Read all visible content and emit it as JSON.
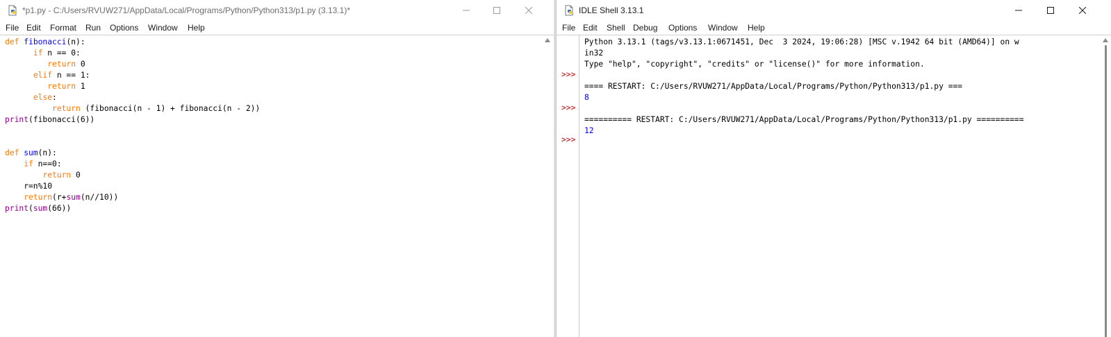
{
  "editor": {
    "title": "*p1.py - C:/Users/RVUW271/AppData/Local/Programs/Python/Python313/p1.py (3.13.1)*",
    "menu": [
      "File",
      "Edit",
      "Format",
      "Run",
      "Options",
      "Window",
      "Help"
    ],
    "code_lines": [
      [
        {
          "t": "def",
          "c": "k"
        },
        {
          "t": " "
        },
        {
          "t": "fibonacci",
          "c": "d"
        },
        {
          "t": "(n):"
        }
      ],
      [
        {
          "t": "      "
        },
        {
          "t": "if",
          "c": "k"
        },
        {
          "t": " n == 0:"
        }
      ],
      [
        {
          "t": "         "
        },
        {
          "t": "return",
          "c": "k"
        },
        {
          "t": " 0"
        }
      ],
      [
        {
          "t": "      "
        },
        {
          "t": "elif",
          "c": "k"
        },
        {
          "t": " n == 1:"
        }
      ],
      [
        {
          "t": "         "
        },
        {
          "t": "return",
          "c": "k"
        },
        {
          "t": " 1"
        }
      ],
      [
        {
          "t": "      "
        },
        {
          "t": "else",
          "c": "k"
        },
        {
          "t": ":"
        }
      ],
      [
        {
          "t": "          "
        },
        {
          "t": "return",
          "c": "k"
        },
        {
          "t": " (fibonacci(n - 1) + fibonacci(n - 2))"
        }
      ],
      [
        {
          "t": "print",
          "c": "b"
        },
        {
          "t": "(fibonacci(6))"
        }
      ],
      [],
      [],
      [
        {
          "t": "def",
          "c": "k"
        },
        {
          "t": " "
        },
        {
          "t": "sum",
          "c": "d"
        },
        {
          "t": "(n):"
        }
      ],
      [
        {
          "t": "    "
        },
        {
          "t": "if",
          "c": "k"
        },
        {
          "t": " n==0:"
        }
      ],
      [
        {
          "t": "        "
        },
        {
          "t": "return",
          "c": "k"
        },
        {
          "t": " 0"
        }
      ],
      [
        {
          "t": "    r=n%10"
        }
      ],
      [
        {
          "t": "    "
        },
        {
          "t": "return",
          "c": "k"
        },
        {
          "t": "(r+"
        },
        {
          "t": "sum",
          "c": "b"
        },
        {
          "t": "(n//10))"
        }
      ],
      [
        {
          "t": "print",
          "c": "b"
        },
        {
          "t": "("
        },
        {
          "t": "sum",
          "c": "b"
        },
        {
          "t": "(66))"
        }
      ]
    ]
  },
  "shell": {
    "title": "IDLE Shell 3.13.1",
    "menu": [
      "File",
      "Edit",
      "Shell",
      "Debug",
      "Options",
      "Window",
      "Help"
    ],
    "prompt": ">>>",
    "lines": [
      {
        "t": "Python 3.13.1 (tags/v3.13.1:0671451, Dec  3 2024, 19:06:28) [MSC v.1942 64 bit (AMD64)] on w"
      },
      {
        "t": "in32"
      },
      {
        "t": "Type \"help\", \"copyright\", \"credits\" or \"license()\" for more information."
      },
      {
        "t": ""
      },
      {
        "t": "==== RESTART: C:/Users/RVUW271/AppData/Local/Programs/Python/Python313/p1.py ==="
      },
      {
        "t": "8",
        "c": "out"
      },
      {
        "t": ""
      },
      {
        "t": "========== RESTART: C:/Users/RVUW271/AppData/Local/Programs/Python/Python313/p1.py =========="
      },
      {
        "t": "12",
        "c": "out"
      }
    ]
  },
  "colors": {
    "keyword": "#ff7700",
    "builtin": "#900090",
    "definition": "#0000ff",
    "stdout": "#0000ff",
    "prompt": "#c00000"
  },
  "icons": [
    "python-file-icon",
    "minimize-icon",
    "maximize-icon",
    "close-icon",
    "scroll-up-arrow-icon"
  ]
}
